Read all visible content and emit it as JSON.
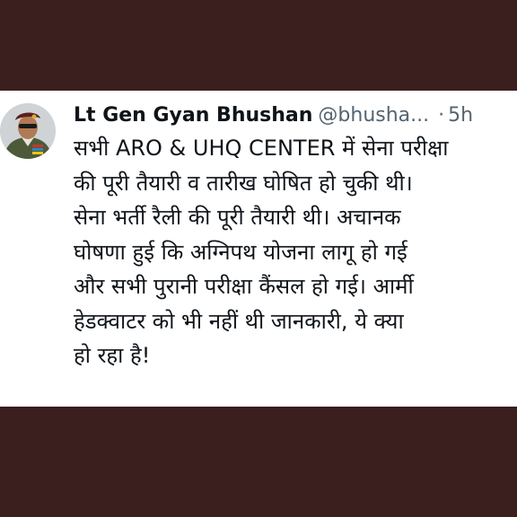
{
  "tweet": {
    "author_name": "Lt Gen Gyan Bhushan",
    "handle": "@bhusha...",
    "separator": "·",
    "time": "5h",
    "lines": [
      "सभी ARO & UHQ CENTER में सेना परीक्षा",
      "की पूरी तैयारी व तारीख घोषित हो चुकी थी।",
      "सेना भर्ती रैली की पूरी तैयारी थी। अचानक",
      "घोषणा हुई कि अग्निपथ योजना लागू हो गई",
      "और सभी पुरानी परीक्षा कैंसल हो गई। आर्मी",
      "हेडक्वाटर को भी नहीं थी जानकारी, ये क्या",
      "हो रहा है!"
    ]
  },
  "colors": {
    "frame_background": "#3b1e1e",
    "card_background": "#ffffff",
    "text": "#0f1419",
    "muted": "#536471"
  }
}
